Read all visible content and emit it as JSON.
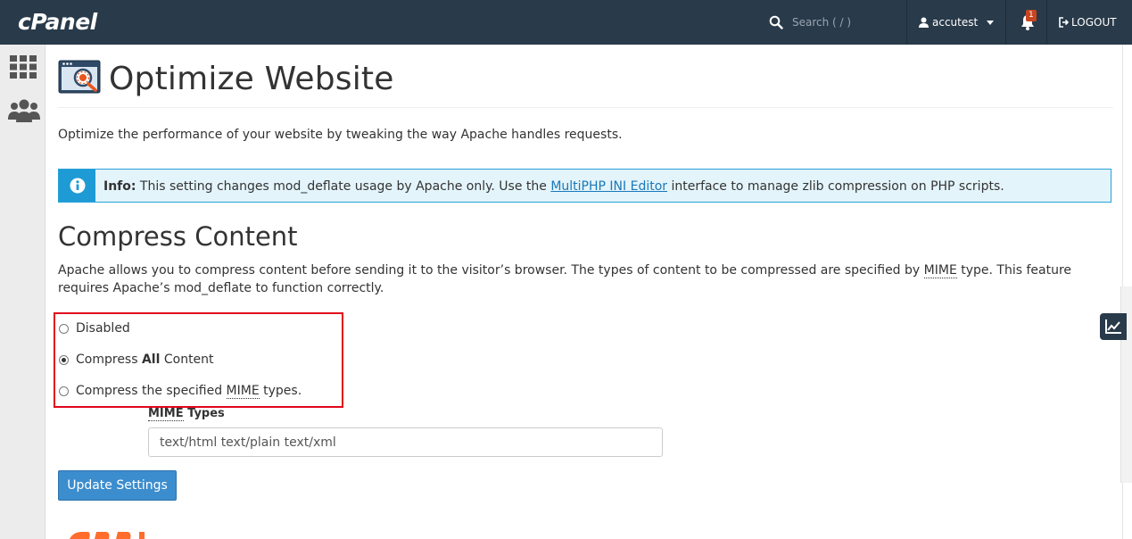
{
  "header": {
    "brand": "cPanel",
    "search_placeholder": "Search ( / )",
    "username": "accutest",
    "notification_count": "1",
    "logout_label": "LOGOUT"
  },
  "page": {
    "title": "Optimize Website",
    "description": "Optimize the performance of your website by tweaking the way Apache handles requests."
  },
  "info": {
    "label": "Info:",
    "text_before": " This setting changes mod_deflate usage by Apache only. Use the ",
    "link_text": "MultiPHP INI Editor",
    "text_after": " interface to manage zlib compression on PHP scripts."
  },
  "compress": {
    "title": "Compress Content",
    "desc_part1": "Apache allows you to compress content before sending it to the visitor’s browser. The types of content to be compressed are specified by ",
    "desc_abbr": "MIME",
    "desc_part2": " type. This feature requires Apache’s mod_deflate to function correctly.",
    "options": {
      "disabled": "Disabled",
      "all_prefix": "Compress ",
      "all_bold": "All",
      "all_suffix": " Content",
      "specified_prefix": "Compress the specified ",
      "specified_abbr": "MIME",
      "specified_suffix": " types."
    },
    "selected": "all",
    "mime_label_abbr": "MIME",
    "mime_label_rest": " Types",
    "mime_value": "text/html text/plain text/xml",
    "update_button": "Update Settings"
  },
  "colors": {
    "header_bg": "#293a4a",
    "info_border": "#28a1d7",
    "button_bg": "#3c8dce",
    "highlight": "#e0061a",
    "footer_logo": "#ff6c2c"
  }
}
